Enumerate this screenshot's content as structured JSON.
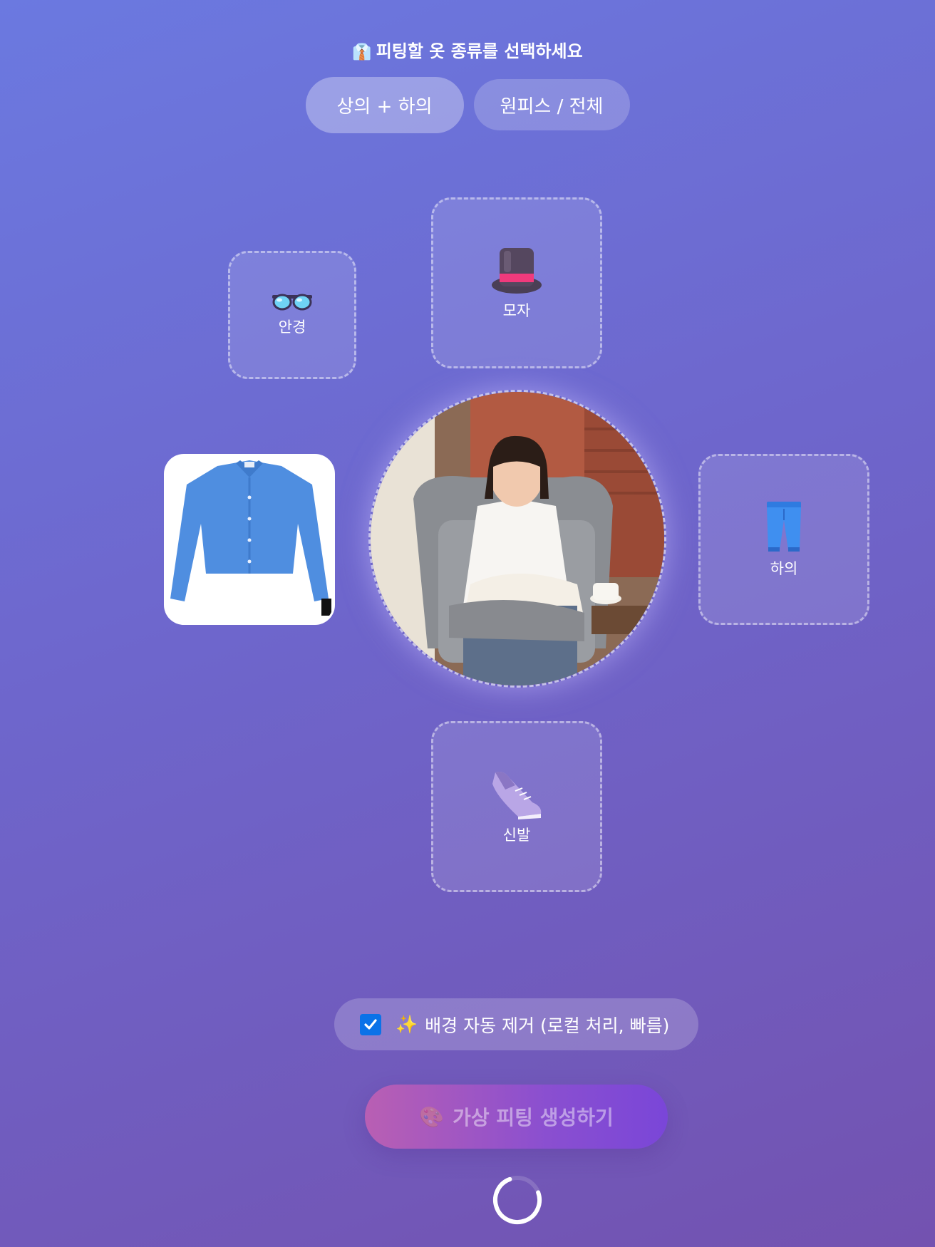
{
  "heading": {
    "emoji": "👔",
    "text": "피팅할 옷 종류를 선택하세요"
  },
  "tabs": [
    {
      "label": "상의 + 하의",
      "active": true
    },
    {
      "label": "원피스 / 전체",
      "active": false
    }
  ],
  "slots": {
    "glasses": {
      "icon": "glasses-icon",
      "label": "안경"
    },
    "hat": {
      "icon": "top-hat-icon",
      "label": "모자"
    },
    "top": {
      "image": "blue-shirt-image"
    },
    "bottom": {
      "icon": "jeans-icon",
      "label": "하의"
    },
    "shoes": {
      "icon": "sneaker-icon",
      "label": "신발"
    }
  },
  "person": {
    "image": "person-reading-photo"
  },
  "bg_option": {
    "checked": true,
    "emoji": "✨",
    "label": "배경 자동 제거 (로컬 처리, 빠름)"
  },
  "generate": {
    "emoji": "🎨",
    "label": "가상 피팅 생성하기",
    "disabled": true
  },
  "colors": {
    "checkbox": "#0a72e8",
    "shirt": "#4f8ee0",
    "button_start": "#b95fb3",
    "button_end": "#7a46d8"
  }
}
